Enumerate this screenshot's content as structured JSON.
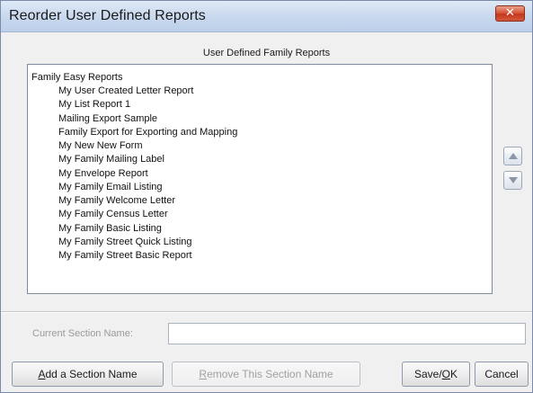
{
  "window": {
    "title": "Reorder User Defined Reports",
    "close_glyph": "✕"
  },
  "group": {
    "header": "User Defined Family Reports"
  },
  "reports": {
    "root": "Family Easy Reports",
    "items": [
      "My User Created Letter Report",
      "My List Report 1",
      "Mailing Export Sample",
      "Family Export for Exporting and Mapping",
      "My New New Form",
      "My Family Mailing Label",
      "My Envelope Report",
      "My Family Email Listing",
      "My Family Welcome Letter",
      "My Family Census Letter",
      "My Family Basic Listing",
      "My Family Street Quick Listing",
      "My Family Street Basic Report"
    ]
  },
  "reorder": {
    "up_icon": "triangle-up-icon",
    "down_icon": "triangle-down-icon"
  },
  "section": {
    "label": "Current Section Name:",
    "value": ""
  },
  "buttons": {
    "add_section": {
      "mnemonic": "A",
      "rest": "dd a Section Name"
    },
    "remove_section": {
      "mnemonic": "R",
      "rest": "emove This Section Name"
    },
    "save_ok": {
      "prefix": "Save/",
      "mnemonic": "O",
      "rest": "K"
    },
    "cancel": "Cancel"
  },
  "colors": {
    "close_red": "#c4381d",
    "title_blue": "#c9d9ee",
    "disabled_text": "#a0a0a0"
  }
}
